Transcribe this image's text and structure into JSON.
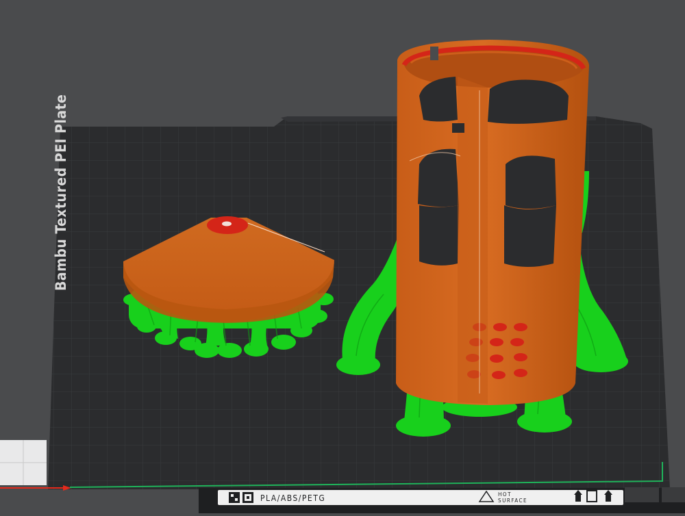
{
  "plate": {
    "name": "Bambu Textured PEI Plate",
    "filament_label": "PLA/ABS/PETG",
    "hot_surface_line1": "HOT",
    "hot_surface_line2": "SURFACE"
  },
  "colors": {
    "background": "#4a4b4d",
    "plate": "#2b2c2e",
    "grid": "#3c3d40",
    "model_orange": "#d0651e",
    "model_red": "#d42518",
    "support_green": "#18d01c",
    "axis_x": "#e52a1c",
    "axis_y": "#1fb35a"
  },
  "icons": {
    "plate_logo": "plate-logo-icon",
    "plate_qr": "plate-qr-icon",
    "hot_surface_warning": "warning-triangle-icon",
    "orientation_a": "up-arrow-icon",
    "orientation_b": "square-outline-icon",
    "orientation_c": "up-arrow-icon"
  },
  "objects": [
    {
      "name": "cone-lid",
      "color": "model_orange"
    },
    {
      "name": "slotted-cylinder",
      "color": "model_orange"
    },
    {
      "name": "tree-supports",
      "color": "support_green"
    }
  ]
}
